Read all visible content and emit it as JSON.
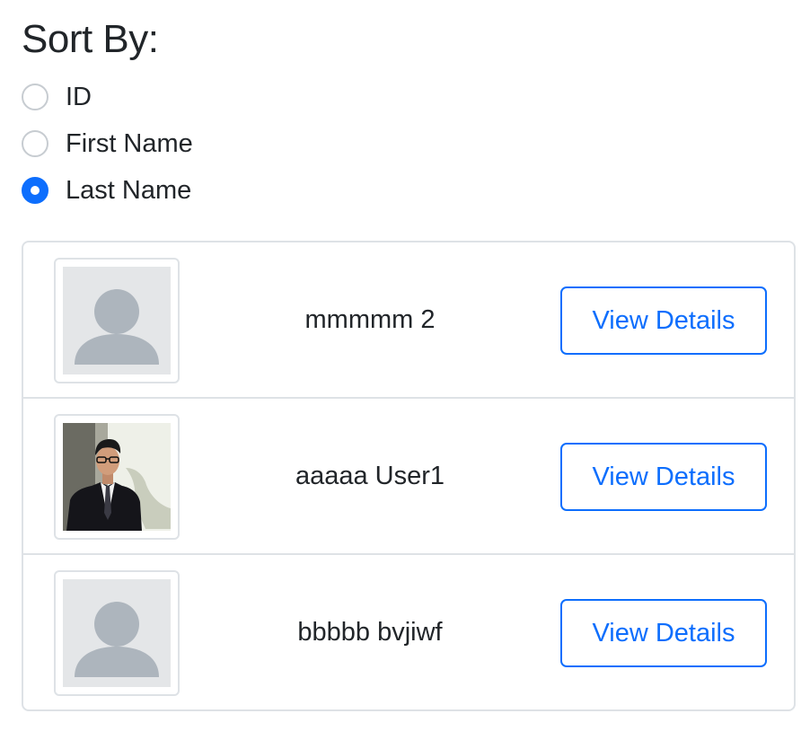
{
  "sort": {
    "heading": "Sort By:",
    "options": [
      {
        "label": "ID",
        "selected": false
      },
      {
        "label": "First Name",
        "selected": false
      },
      {
        "label": "Last Name",
        "selected": true
      }
    ]
  },
  "users": [
    {
      "name": "mmmmm 2",
      "avatar": "default-avatar-icon",
      "button_label": "View Details"
    },
    {
      "name": "aaaaa User1",
      "avatar": "profile-photo",
      "button_label": "View Details"
    },
    {
      "name": "bbbbb bvjiwf",
      "avatar": "default-avatar-icon",
      "button_label": "View Details"
    }
  ],
  "colors": {
    "primary": "#0d6efd",
    "text": "#212529",
    "border": "#dee2e6",
    "avatar_bg": "#e4e6e8",
    "avatar_fg": "#adb5bd"
  }
}
